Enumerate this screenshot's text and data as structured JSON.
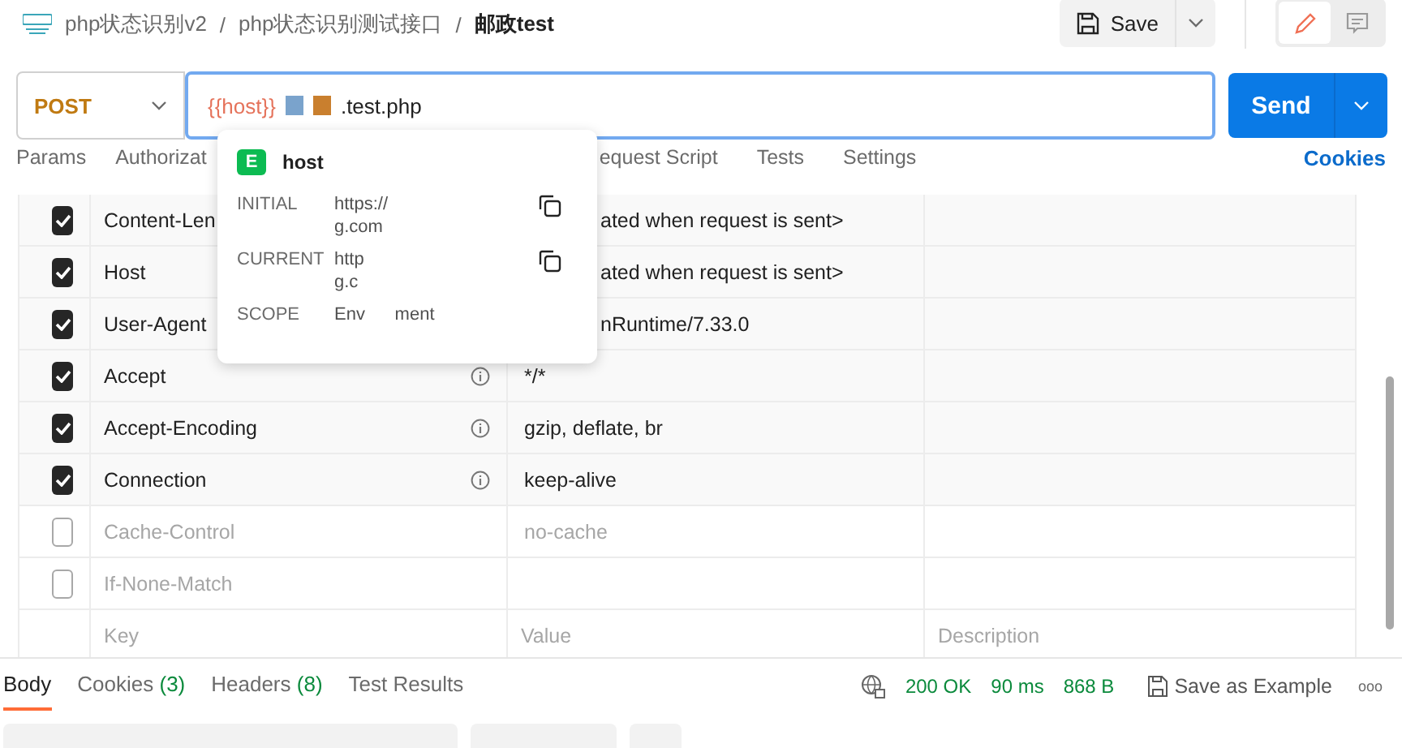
{
  "breadcrumb": [
    "php状态识别v2",
    "php状态识别测试接口",
    "邮政test"
  ],
  "breadcrumb_separator": "/",
  "save": {
    "label": "Save"
  },
  "mode_toggle": [
    {
      "kind": "edit",
      "selected": true
    },
    {
      "kind": "comment",
      "selected": false
    }
  ],
  "request": {
    "method": "POST",
    "url_variable": "{{host}}",
    "url_rest": ".test.php"
  },
  "send": {
    "label": "Send"
  },
  "request_tabs": [
    {
      "label": "Params"
    },
    {
      "label": "Authorizat"
    },
    {
      "label": "equest Script"
    },
    {
      "label": "Tests"
    },
    {
      "label": "Settings"
    }
  ],
  "cookies_link": "Cookies",
  "headers": [
    {
      "checked": true,
      "key": "Content-Len",
      "info": false,
      "value": "ated when request is sent>"
    },
    {
      "checked": true,
      "key": "Host",
      "info": false,
      "value": "ated when request is sent>"
    },
    {
      "checked": true,
      "key": "User-Agent",
      "info": false,
      "value": "nRuntime/7.33.0"
    },
    {
      "checked": true,
      "key": "Accept",
      "info": true,
      "value": "*/*"
    },
    {
      "checked": true,
      "key": "Accept-Encoding",
      "info": true,
      "value": "gzip, deflate, br"
    },
    {
      "checked": true,
      "key": "Connection",
      "info": true,
      "value": "keep-alive"
    },
    {
      "checked": false,
      "key": "Cache-Control",
      "info": false,
      "value": "no-cache"
    },
    {
      "checked": false,
      "key": "If-None-Match",
      "info": false
    }
  ],
  "new_row": {
    "key_placeholder": "Key",
    "value_placeholder": "Value",
    "description_placeholder": "Description"
  },
  "variable_popup": {
    "badge": "E",
    "name": "host",
    "rows": [
      {
        "label": "INITIAL",
        "lines": [
          "https://",
          "g.com"
        ],
        "copy": true
      },
      {
        "label": "CURRENT",
        "lines": [
          "http",
          "g.c"
        ],
        "copy": true
      },
      {
        "label": "SCOPE",
        "lines": [
          "Env      ment"
        ],
        "copy": false
      }
    ]
  },
  "response_tabs": [
    {
      "label": "Body",
      "selected": true
    },
    {
      "label": "Cookies",
      "count": "(3)",
      "selected": false
    },
    {
      "label": "Headers",
      "count": "(8)",
      "selected": false
    },
    {
      "label": "Test Results",
      "selected": false
    }
  ],
  "response_status": {
    "status": "200 OK",
    "time": "90 ms",
    "size": "868 B",
    "save_example": "Save as Example",
    "more": "ooo"
  }
}
